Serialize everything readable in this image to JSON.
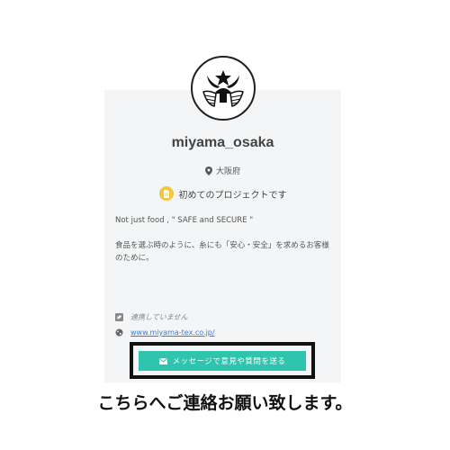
{
  "profile": {
    "username": "miyama_osaka",
    "location": "大阪府",
    "project_badge": "初めてのプロジェクトです"
  },
  "bio": {
    "line1": "Not just food , \" SAFE and SECURE \"",
    "line2": "食品を選ぶ時のように、糸にも「安心・安全」を求めるお客様のために。"
  },
  "links": {
    "twitter_text": "連携していません",
    "website_text": "www.miyama-tex.co.jp/"
  },
  "button": {
    "message_label": "メッセージで意見や質問を送る"
  },
  "caption": "こちらへご連絡お願い致します。",
  "colors": {
    "button_bg": "#2fc4ae",
    "badge_bg": "#f3c63d",
    "link": "#3a7bd5"
  }
}
